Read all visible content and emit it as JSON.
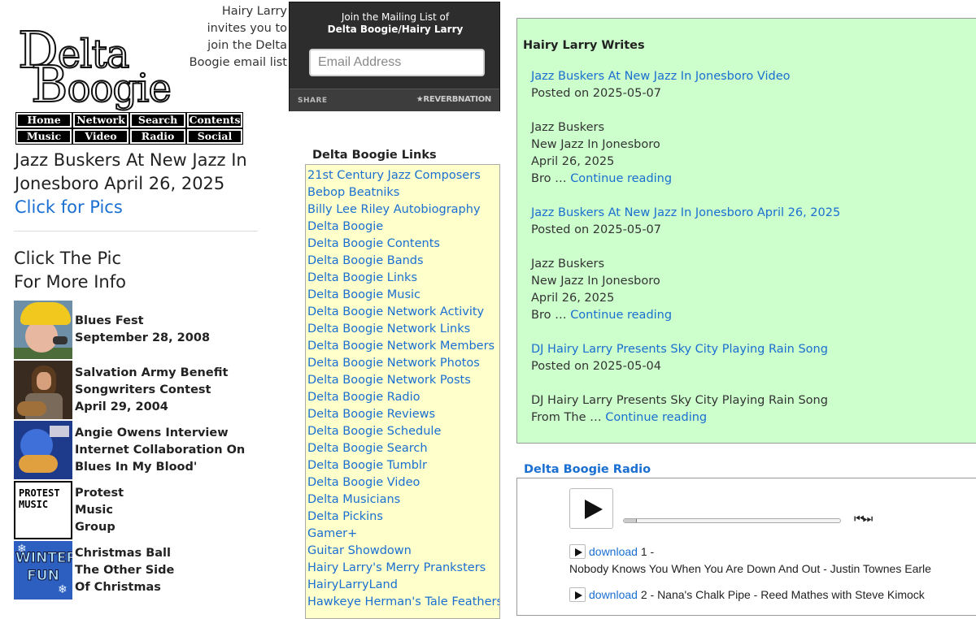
{
  "logo": {
    "line1": "Delta",
    "line2": "Boogie"
  },
  "nav": {
    "row1": [
      "Home",
      "Network",
      "Search",
      "Contents"
    ],
    "row2": [
      "Music",
      "Video",
      "Radio",
      "Social"
    ]
  },
  "feature": {
    "title": "Jazz Buskers At New Jazz In Jonesboro April 26, 2025",
    "link": "Click for Pics"
  },
  "click_pic": {
    "line1": "Click The Pic",
    "line2": "For More Info"
  },
  "items": [
    {
      "lines": [
        "Blues Fest",
        "September 28, 2008"
      ]
    },
    {
      "lines": [
        "Salvation Army Benefit",
        "Songwriters Contest",
        "April 29, 2004"
      ]
    },
    {
      "lines": [
        "Angie Owens Interview",
        "Internet Collaboration On",
        "Blues In My Blood'"
      ]
    },
    {
      "lines": [
        "Protest",
        "Music",
        "Group"
      ],
      "thumb_text": "PROTEST MUSIC"
    },
    {
      "lines": [
        "Christmas Ball",
        "The Other Side",
        "Of Christmas"
      ],
      "thumb_text": "WINTER FUN"
    }
  ],
  "mailing": {
    "invite": "Hairy Larry invites you to join the Delta Boogie email list",
    "title_line1": "Join the Mailing List of",
    "title_line2": "Delta Boogie/Hairy Larry",
    "placeholder": "Email Address",
    "share": "SHARE",
    "brand": "★REVERBNATION"
  },
  "links": {
    "heading": "Delta Boogie Links",
    "items": [
      "21st Century Jazz Composers",
      "Bebop Beatniks",
      "Billy Lee Riley Autobiography",
      "Delta Boogie",
      "Delta Boogie Contents",
      "Delta Boogie Bands",
      "Delta Boogie Links",
      "Delta Boogie Music",
      "Delta Boogie Network Activity",
      "Delta Boogie Network Links",
      "Delta Boogie Network Members",
      "Delta Boogie Network Photos",
      "Delta Boogie Network Posts",
      "Delta Boogie Radio",
      "Delta Boogie Reviews",
      "Delta Boogie Schedule",
      "Delta Boogie Search",
      "Delta Boogie Tumblr",
      "Delta Boogie Video",
      "Delta Musicians",
      "Delta Pickins",
      "Gamer+",
      "Guitar Showdown",
      "Hairy Larry's Merry Pranksters",
      "HairyLarryLand",
      "Hawkeye Herman's Tale Feathers"
    ]
  },
  "writes": {
    "heading": "Hairy Larry Writes",
    "continue": "Continue reading",
    "posts": [
      {
        "title": "Jazz Buskers At New Jazz In Jonesboro Video",
        "meta": "Posted on 2025-05-07",
        "excerpt": [
          "Jazz Buskers",
          "New Jazz In Jonesboro",
          "April 26, 2025"
        ],
        "tail": "Bro … "
      },
      {
        "title": "Jazz Buskers At New Jazz In Jonesboro April 26, 2025",
        "meta": "Posted on 2025-05-07",
        "excerpt": [
          "Jazz Buskers",
          "New Jazz In Jonesboro",
          "April 26, 2025"
        ],
        "tail": "Bro … "
      },
      {
        "title": "DJ Hairy Larry Presents Sky City Playing Rain Song",
        "meta": "Posted on 2025-05-04",
        "excerpt": [
          "DJ Hairy Larry Presents Sky City Playing Rain Song"
        ],
        "tail": "From The … "
      }
    ]
  },
  "radio": {
    "heading": "Delta Boogie Radio",
    "progress": 0.06,
    "skip": "⏮⏭",
    "download": "download",
    "tracks": [
      {
        "num": "1 -",
        "title": "Nobody Knows You When You Are Down And Out - Justin Townes Earle"
      },
      {
        "num": "2 -",
        "title": "Nana's Chalk Pipe - Reed Mathes with Steve Kimock"
      }
    ]
  }
}
